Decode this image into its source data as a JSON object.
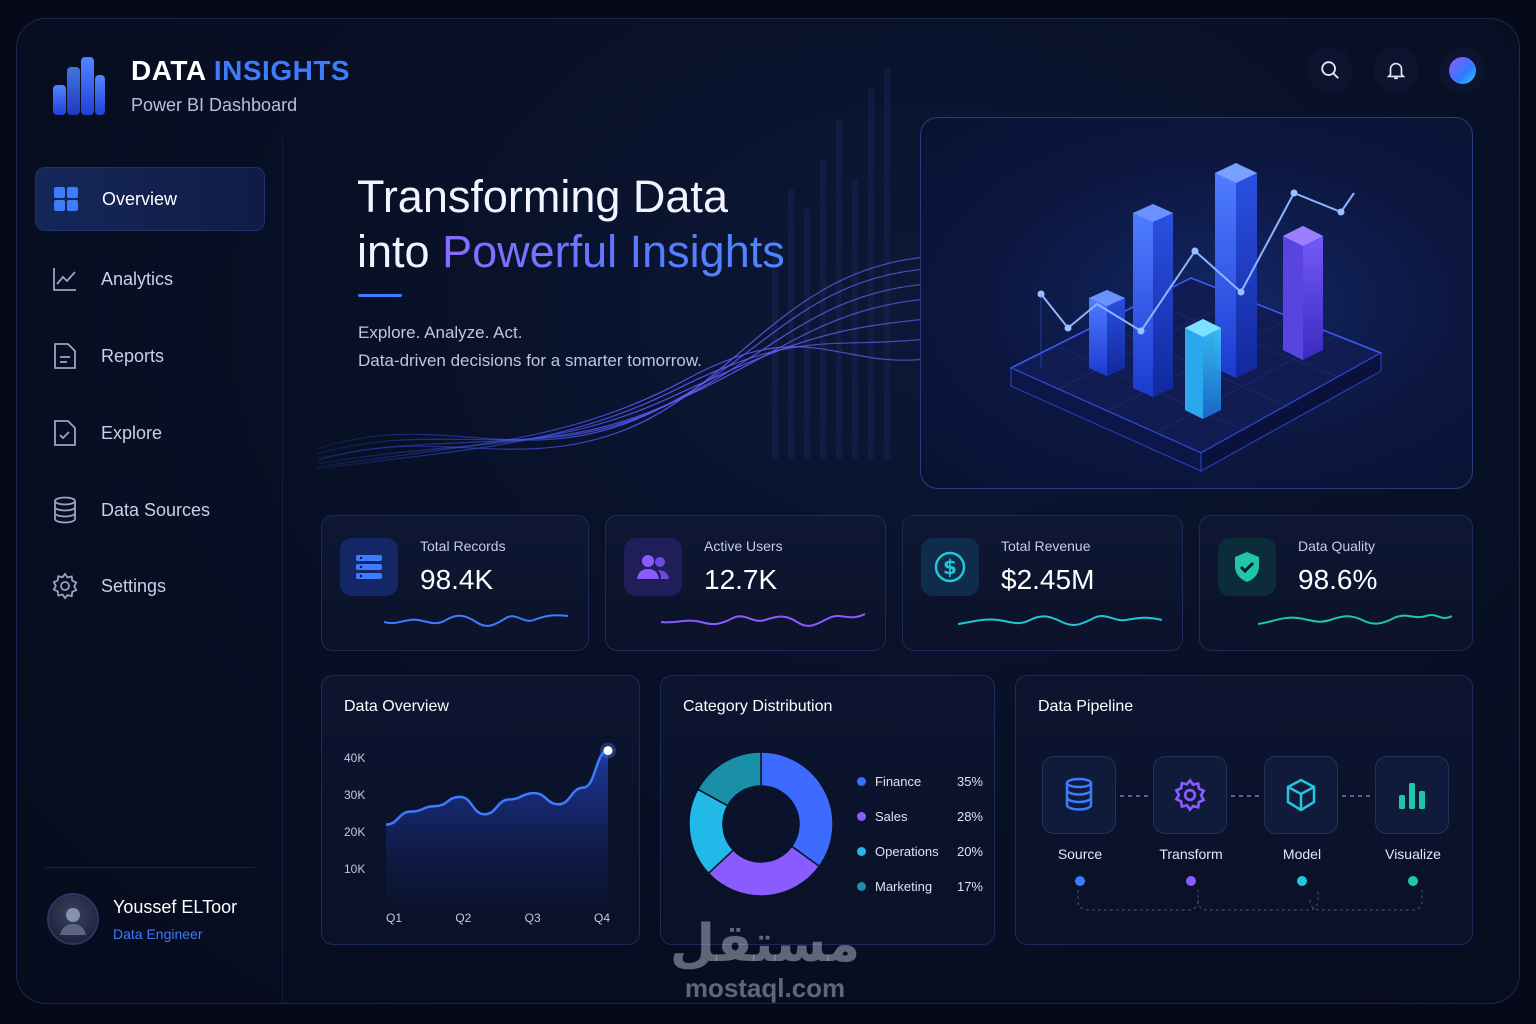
{
  "header": {
    "brand_word1": "DATA",
    "brand_word2": "INSIGHTS",
    "subtitle": "Power BI Dashboard",
    "icons": [
      "search-icon",
      "bell-icon",
      "profile-avatar"
    ]
  },
  "sidebar": {
    "items": [
      {
        "label": "Overview",
        "icon": "grid-icon",
        "active": true
      },
      {
        "label": "Analytics",
        "icon": "line-chart-icon"
      },
      {
        "label": "Reports",
        "icon": "document-icon"
      },
      {
        "label": "Explore",
        "icon": "explore-icon"
      },
      {
        "label": "Data Sources",
        "icon": "database-icon"
      },
      {
        "label": "Settings",
        "icon": "gear-icon"
      }
    ],
    "user": {
      "name": "Youssef ELToor",
      "role": "Data Engineer"
    }
  },
  "hero": {
    "line1": "Transforming Data",
    "line2_plain": "into ",
    "line2_accent": "Powerful Insights",
    "tagline1": "Explore. Analyze. Act.",
    "tagline2": "Data-driven decisions for a smarter tomorrow."
  },
  "kpis": [
    {
      "label": "Total Records",
      "value": "98.4K",
      "icon": "server-icon",
      "color": "#3d7bff"
    },
    {
      "label": "Active Users",
      "value": "12.7K",
      "icon": "users-icon",
      "color": "#8a5cff"
    },
    {
      "label": "Total Revenue",
      "value": "$2.45M",
      "icon": "dollar-icon",
      "color": "#22c7d6"
    },
    {
      "label": "Data Quality",
      "value": "98.6%",
      "icon": "shield-check-icon",
      "color": "#1fc7a8"
    }
  ],
  "data_overview": {
    "title": "Data Overview",
    "chart_data": {
      "type": "area",
      "categories": [
        "Q1",
        "Q2",
        "Q3",
        "Q4"
      ],
      "y_ticks": [
        "40K",
        "30K",
        "20K",
        "10K"
      ],
      "ylim": [
        0,
        40000
      ],
      "values": [
        22000,
        25500,
        27000,
        29500,
        24800,
        28800,
        30500,
        27500,
        32000,
        42000
      ],
      "color": "#3d7bff"
    }
  },
  "category_distribution": {
    "title": "Category Distribution",
    "chart_data": {
      "type": "pie",
      "slices": [
        {
          "name": "Finance",
          "value": 35,
          "label": "35%",
          "color": "#3d6bff"
        },
        {
          "name": "Sales",
          "value": 28,
          "label": "28%",
          "color": "#8a5cff"
        },
        {
          "name": "Operations",
          "value": 20,
          "label": "20%",
          "color": "#22b8e8"
        },
        {
          "name": "Marketing",
          "value": 17,
          "label": "17%",
          "color": "#1a8fa8"
        }
      ]
    }
  },
  "pipeline": {
    "title": "Data Pipeline",
    "stages": [
      {
        "label": "Source",
        "icon": "database-icon",
        "color": "#3d7bff"
      },
      {
        "label": "Transform",
        "icon": "gear-icon",
        "color": "#8a5cff"
      },
      {
        "label": "Model",
        "icon": "cube-icon",
        "color": "#22c7e0"
      },
      {
        "label": "Visualize",
        "icon": "bar-chart-icon",
        "color": "#1fc7a8"
      }
    ]
  },
  "watermark": {
    "arabic": "مستقل",
    "latin": "mostaql.com"
  }
}
